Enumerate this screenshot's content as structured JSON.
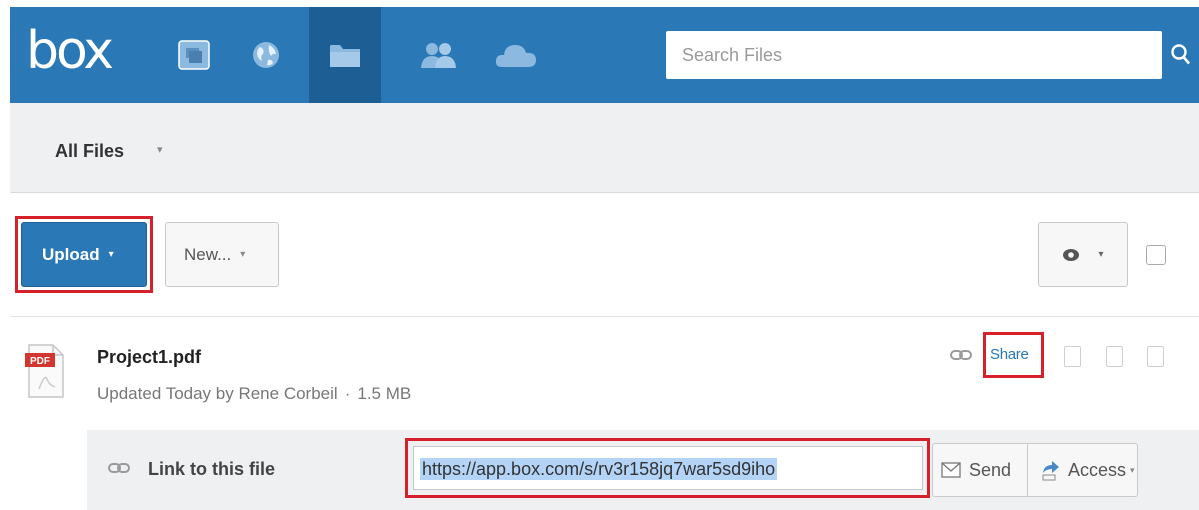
{
  "header": {
    "logo_text": "box",
    "nav_icons": [
      "updates-icon",
      "globe-icon",
      "folder-icon",
      "people-icon",
      "cloud-icon"
    ],
    "active_nav": "folder-icon",
    "search_placeholder": "Search Files"
  },
  "breadcrumb": {
    "label": "All Files",
    "caret": "▾"
  },
  "toolbar": {
    "upload_label": "Upload",
    "new_label": "New...",
    "caret": "▾"
  },
  "file": {
    "name": "Project1.pdf",
    "meta": "Updated Today by Rene Corbeil",
    "meta_sep": "·",
    "size": "1.5 MB",
    "share_label": "Share",
    "icon_badge": "PDF"
  },
  "share_panel": {
    "label": "Link to this file",
    "url": "https://app.box.com/s/rv3r158jq7war5sd9iho",
    "send_label": "Send",
    "access_label": "Access"
  },
  "colors": {
    "brand_blue": "#2a78b5",
    "active_nav_bg": "#1d5f95",
    "highlight_red": "#d6202b",
    "selection_blue": "#b3d3f7"
  }
}
